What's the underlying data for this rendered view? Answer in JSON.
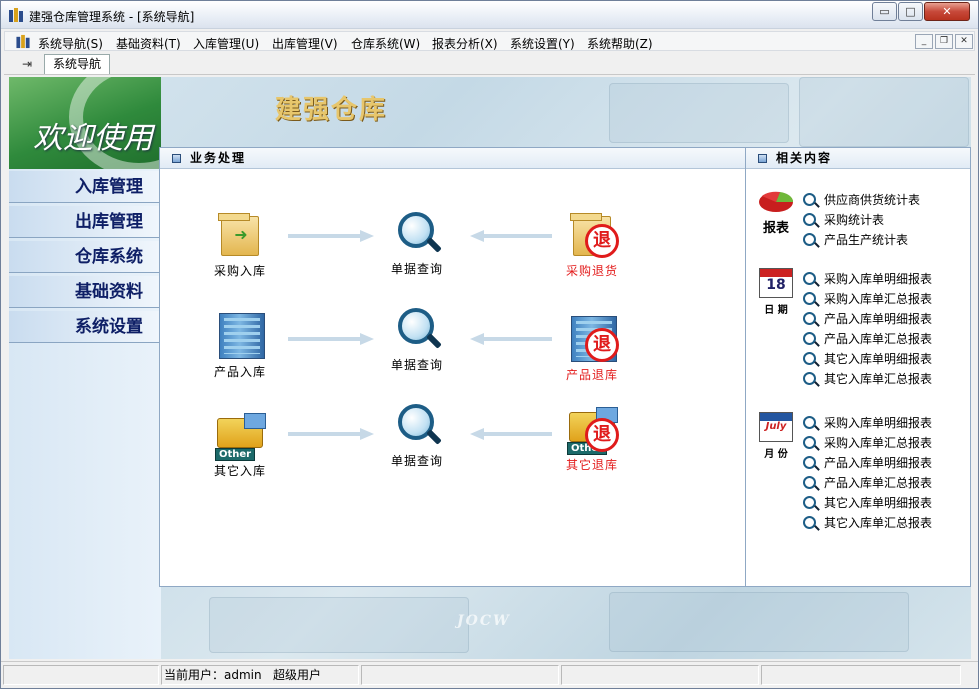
{
  "window": {
    "title": "建强仓库管理系统 - [系统导航]",
    "controls": {
      "minimize": "▭",
      "maximize": "□",
      "close": "✕"
    }
  },
  "menubar": {
    "items": [
      "系统导航(S)",
      "基础资料(T)",
      "入库管理(U)",
      "出库管理(V)",
      "仓库系统(W)",
      "报表分析(X)",
      "系统设置(Y)",
      "系统帮助(Z)"
    ],
    "mdi": {
      "minimize": "_",
      "restore": "❐",
      "close": "✕"
    }
  },
  "toolbar": {
    "tab_label": "系统导航"
  },
  "banner": {
    "welcome": "欢迎使用",
    "brand": "建强仓库"
  },
  "sidebar": {
    "items": [
      "入库管理",
      "出库管理",
      "仓库系统",
      "基础资料",
      "系统设置"
    ]
  },
  "business": {
    "title": "业务处理",
    "rows": [
      {
        "left": "采购入库",
        "center": "单据查询",
        "right": "采购退货"
      },
      {
        "left": "产品入库",
        "center": "单据查询",
        "right": "产品退库"
      },
      {
        "left": "其它入库",
        "center": "单据查询",
        "right": "其它退库"
      }
    ],
    "other_tag": "Other",
    "stamp_char": "退"
  },
  "related": {
    "title": "相关内容",
    "groups": [
      {
        "icon_label": "报表",
        "links": [
          "供应商供货统计表",
          "采购统计表",
          "产品生产统计表"
        ]
      },
      {
        "icon_label": "日 期",
        "calendar_day": "18",
        "links": [
          "采购入库单明细报表",
          "采购入库单汇总报表",
          "产品入库单明细报表",
          "产品入库单汇总报表",
          "其它入库单明细报表",
          "其它入库单汇总报表"
        ]
      },
      {
        "icon_label": "月 份",
        "calendar_month": "July",
        "links": [
          "采购入库单明细报表",
          "采购入库单汇总报表",
          "产品入库单明细报表",
          "产品入库单汇总报表",
          "其它入库单明细报表",
          "其它入库单汇总报表"
        ]
      }
    ]
  },
  "statusbar": {
    "user": "当前用户：admin   超级用户"
  },
  "watermark": "JOCW"
}
